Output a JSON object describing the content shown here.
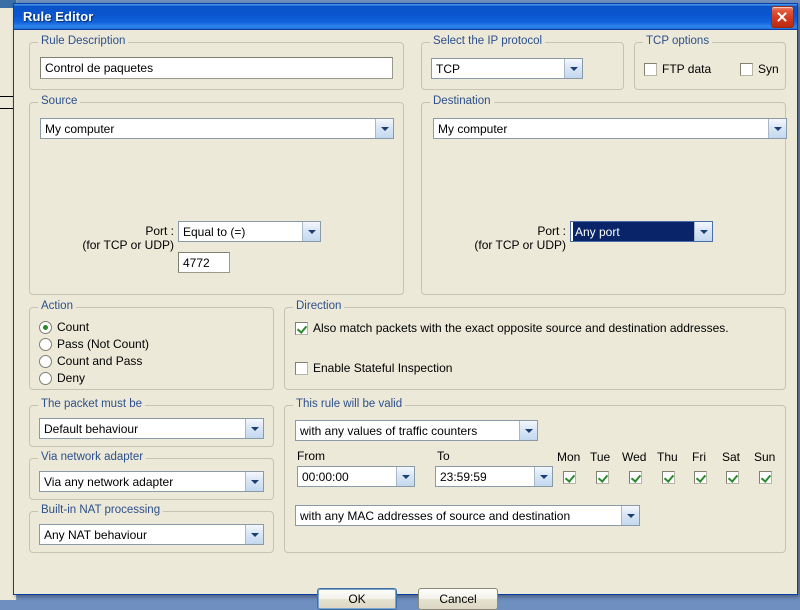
{
  "window": {
    "title": "Rule Editor",
    "close_icon": "close-icon"
  },
  "rule_description": {
    "legend": "Rule Description",
    "value": "Control de paquetes"
  },
  "ip_protocol": {
    "legend": "Select the IP protocol",
    "value": "TCP"
  },
  "tcp_options": {
    "legend": "TCP options",
    "ftp_data": {
      "label": "FTP data",
      "checked": false
    },
    "syn": {
      "label": "Syn",
      "checked": false
    }
  },
  "source": {
    "legend": "Source",
    "address": "My computer",
    "port_label_line1": "Port :",
    "port_label_line2": "(for TCP or UDP)",
    "port_condition": "Equal to (=)",
    "port_value": "4772"
  },
  "destination": {
    "legend": "Destination",
    "address": "My computer",
    "port_label_line1": "Port :",
    "port_label_line2": "(for TCP or UDP)",
    "port_condition": "Any port",
    "port_condition_selected": true
  },
  "action": {
    "legend": "Action",
    "options": [
      {
        "label": "Count",
        "selected": true
      },
      {
        "label": "Pass (Not Count)",
        "selected": false
      },
      {
        "label": "Count and Pass",
        "selected": false
      },
      {
        "label": "Deny",
        "selected": false
      }
    ]
  },
  "direction": {
    "legend": "Direction",
    "opposite": {
      "label": "Also match packets with the exact opposite source and destination addresses.",
      "checked": true
    },
    "stateful": {
      "label": "Enable Stateful Inspection",
      "checked": false
    }
  },
  "packet_must_be": {
    "legend": "The packet must be",
    "value": "Default behaviour"
  },
  "network_adapter": {
    "legend": "Via network adapter",
    "value": "Via any network adapter"
  },
  "nat_processing": {
    "legend": "Built-in NAT processing",
    "value": "Any NAT behaviour"
  },
  "validity": {
    "legend": "This rule will be valid",
    "traffic_counters": "with any values of traffic counters",
    "from_label": "From",
    "to_label": "To",
    "from_value": "00:00:00",
    "to_value": "23:59:59",
    "mac_addresses": "with any MAC addresses of source and destination",
    "days": [
      {
        "label": "Mon",
        "checked": true
      },
      {
        "label": "Tue",
        "checked": true
      },
      {
        "label": "Wed",
        "checked": true
      },
      {
        "label": "Thu",
        "checked": true
      },
      {
        "label": "Fri",
        "checked": true
      },
      {
        "label": "Sat",
        "checked": true
      },
      {
        "label": "Sun",
        "checked": true
      }
    ]
  },
  "footer": {
    "ok_label": "OK",
    "cancel_label": "Cancel"
  },
  "colors": {
    "title_bar_blue": "#0b56cf",
    "group_label_blue": "#2d4f8b",
    "dialog_face": "#ece9d8",
    "selection_blue": "#0a246a",
    "check_green": "#2a8a2a",
    "close_red": "#d23a1d"
  }
}
